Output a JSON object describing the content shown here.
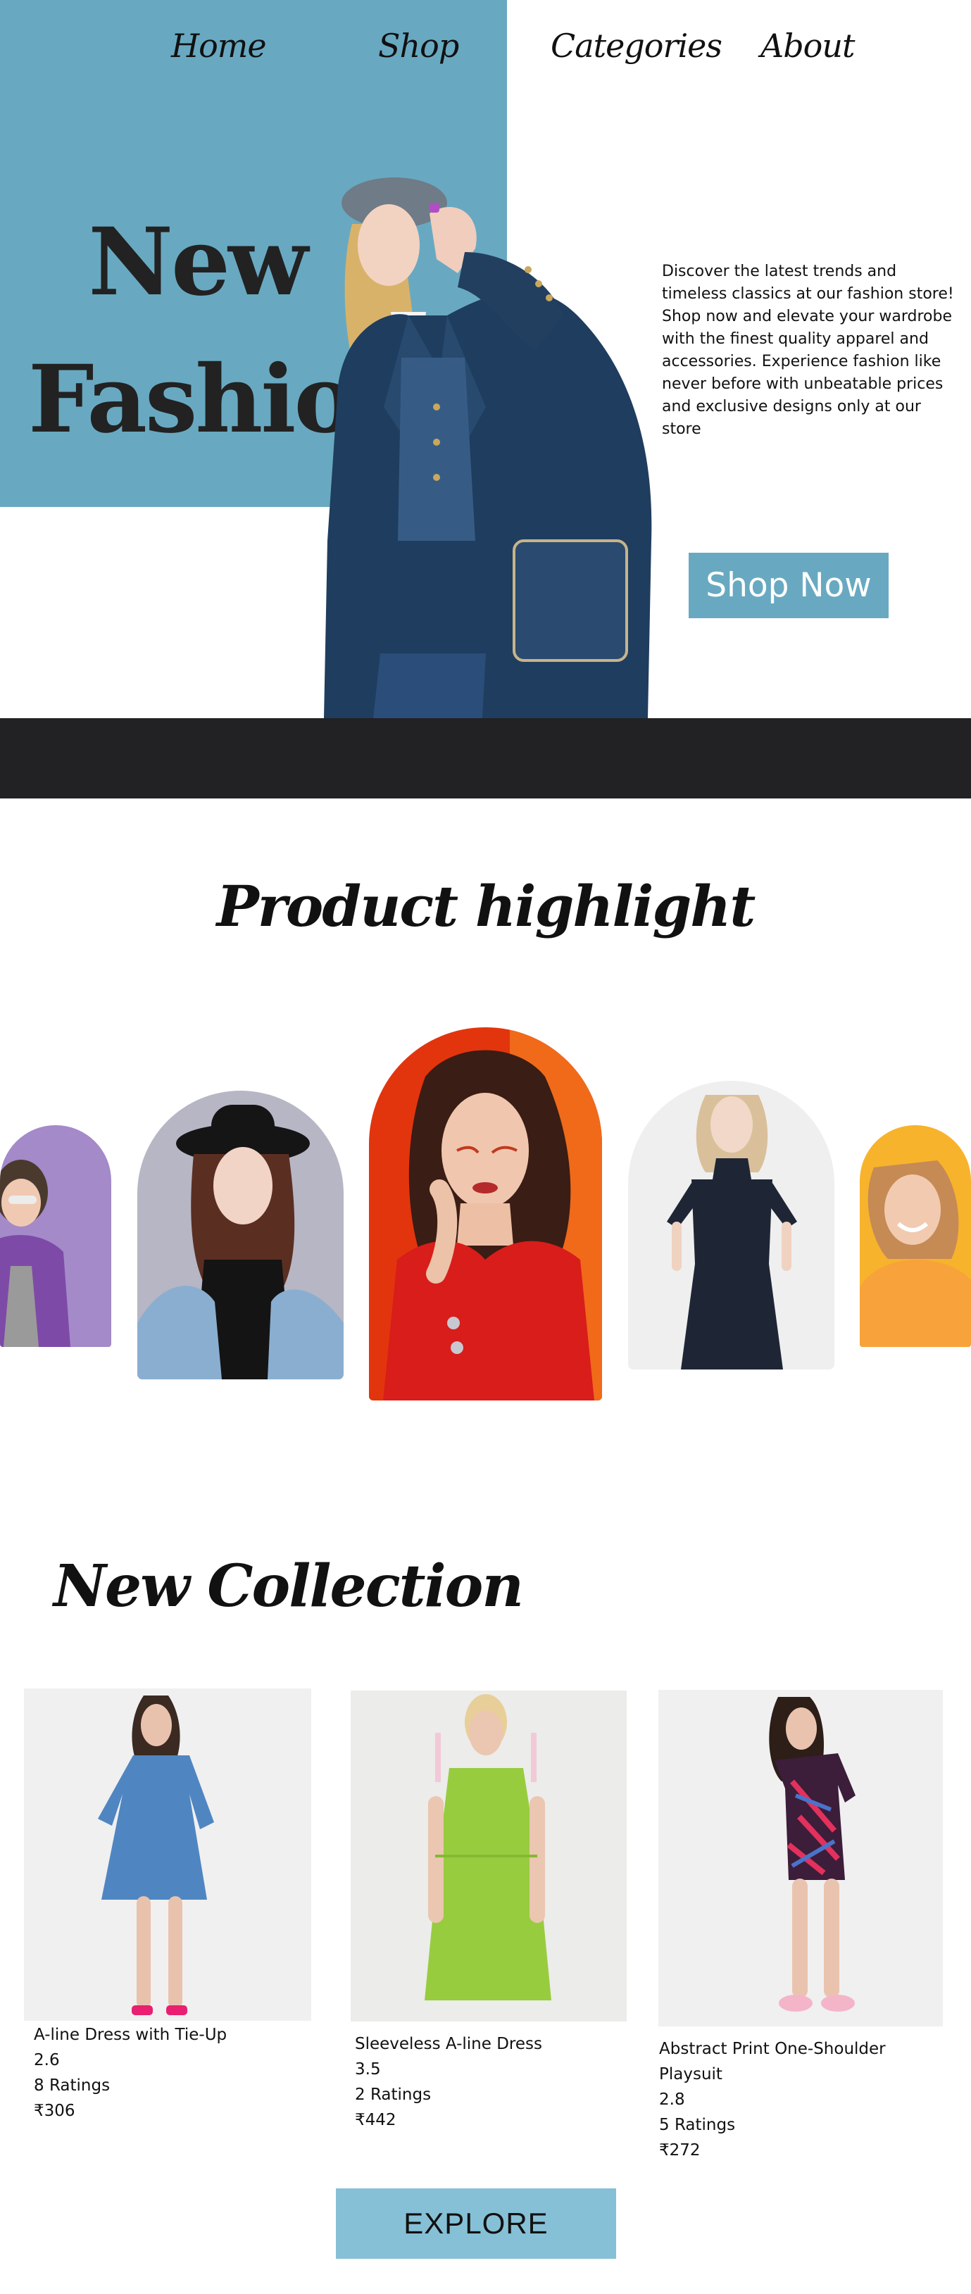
{
  "nav": {
    "items": [
      {
        "label": "Home"
      },
      {
        "label": "Shop"
      },
      {
        "label": "Categories"
      },
      {
        "label": "About"
      }
    ]
  },
  "hero": {
    "title_line1": "New",
    "title_line2": "Fashion",
    "description": "Discover the latest trends and timeless classics at our fashion store! Shop now and elevate your wardrobe with the finest quality apparel and accessories. Experience fashion like never before with unbeatable prices and exclusive designs only at our store",
    "cta_label": "Shop Now"
  },
  "highlight": {
    "title": "Product highlight"
  },
  "collection": {
    "title": "New Collection",
    "products": [
      {
        "name": "A-line Dress with Tie-Up",
        "rating": "2.6",
        "ratings_count": "8 Ratings",
        "price": "₹306"
      },
      {
        "name": "Sleeveless A-line Dress",
        "rating": "3.5",
        "ratings_count": "2 Ratings",
        "price": "₹442"
      },
      {
        "name": "Abstract Print One-Shoulder Playsuit",
        "rating": "2.8",
        "ratings_count": "5 Ratings",
        "price": "₹272"
      }
    ],
    "explore_label": "EXPLORE"
  },
  "colors": {
    "accent": "#68a9c1",
    "explore": "#86c0d6",
    "dark_band": "#222123"
  }
}
